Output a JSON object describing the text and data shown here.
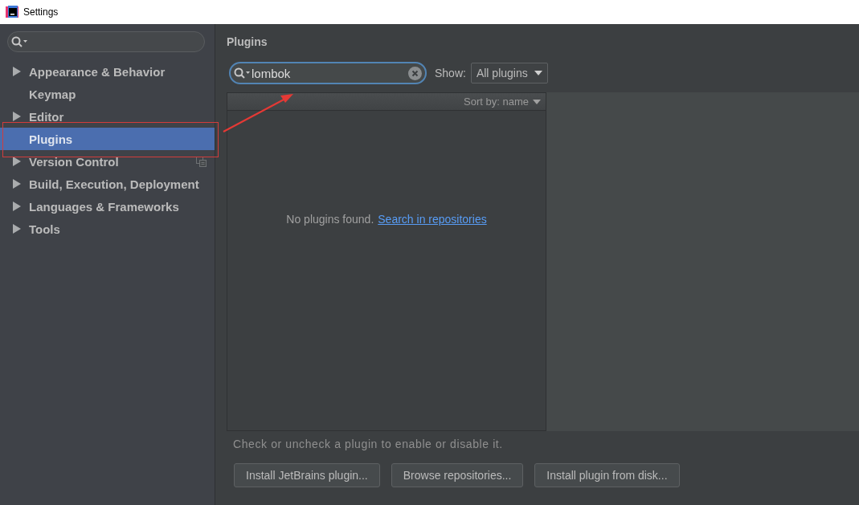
{
  "window": {
    "title": "Settings"
  },
  "sidebar": {
    "items": [
      {
        "label": "Appearance & Behavior",
        "expandable": true,
        "selected": false,
        "project_level": false
      },
      {
        "label": "Keymap",
        "expandable": false,
        "selected": false,
        "project_level": false
      },
      {
        "label": "Editor",
        "expandable": true,
        "selected": false,
        "project_level": false
      },
      {
        "label": "Plugins",
        "expandable": false,
        "selected": true,
        "project_level": false
      },
      {
        "label": "Version Control",
        "expandable": true,
        "selected": false,
        "project_level": true
      },
      {
        "label": "Build, Execution, Deployment",
        "expandable": true,
        "selected": false,
        "project_level": false
      },
      {
        "label": "Languages & Frameworks",
        "expandable": true,
        "selected": false,
        "project_level": false
      },
      {
        "label": "Tools",
        "expandable": true,
        "selected": false,
        "project_level": false
      }
    ]
  },
  "content": {
    "title": "Plugins",
    "search": {
      "value": "lombok"
    },
    "show": {
      "label": "Show:",
      "value": "All plugins"
    },
    "list": {
      "sort": "Sort by: name",
      "empty_text": "No plugins found.",
      "empty_link": "Search in repositories"
    },
    "hint": "Check or uncheck a plugin to enable or disable it.",
    "buttons": [
      "Install JetBrains plugin...",
      "Browse repositories...",
      "Install plugin from disk..."
    ]
  }
}
